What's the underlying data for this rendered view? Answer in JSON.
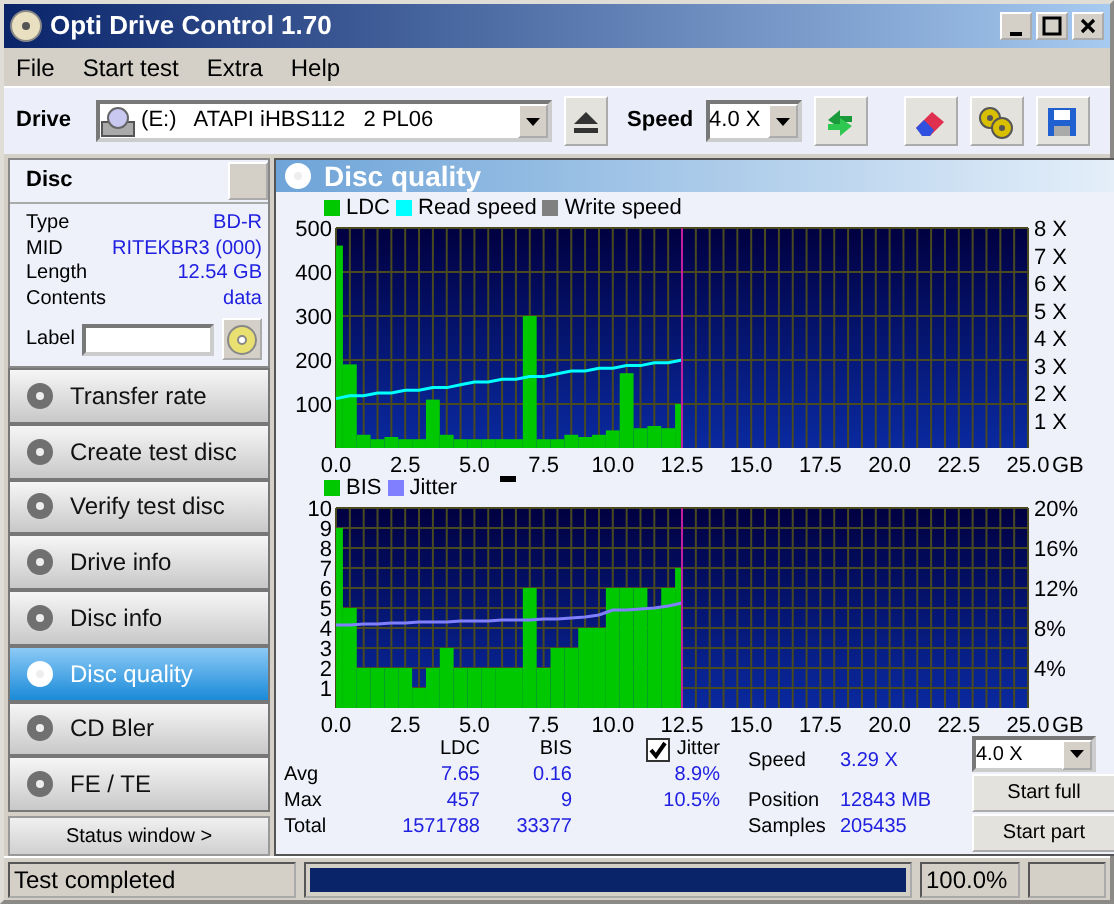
{
  "window": {
    "title": "Opti Drive Control 1.70"
  },
  "menu": [
    "File",
    "Start test",
    "Extra",
    "Help"
  ],
  "toolbar": {
    "drive_label": "Drive",
    "drive": "(E:)   ATAPI iHBS112   2 PL06",
    "speed_label": "Speed",
    "speed": "4.0 X"
  },
  "disc": {
    "title": "Disc",
    "rows": [
      {
        "label": "Type",
        "value": "BD-R"
      },
      {
        "label": "MID",
        "value": "RITEKBR3 (000)"
      },
      {
        "label": "Length",
        "value": "12.54 GB"
      },
      {
        "label": "Contents",
        "value": "data"
      }
    ],
    "label_field": "Label"
  },
  "nav": [
    {
      "label": "Transfer rate",
      "selected": false
    },
    {
      "label": "Create test disc",
      "selected": false
    },
    {
      "label": "Verify test disc",
      "selected": false
    },
    {
      "label": "Drive info",
      "selected": false
    },
    {
      "label": "Disc info",
      "selected": false
    },
    {
      "label": "Disc quality",
      "selected": true
    },
    {
      "label": "CD Bler",
      "selected": false
    },
    {
      "label": "FE / TE",
      "selected": false
    }
  ],
  "status_window_button": "Status window >",
  "panel": {
    "title": "Disc quality",
    "charts": [
      {
        "chart_data": {
          "type": "bar",
          "xlim": [
            0,
            25
          ],
          "ylim": [
            0,
            500
          ],
          "y2lim": [
            0,
            8
          ],
          "grid": true,
          "legend": true,
          "ref_lines": [
            {
              "axis": "x",
              "value": 12.5,
              "color": "#c020a0"
            }
          ],
          "x": [
            0,
            0.5,
            1,
            1.5,
            2,
            2.5,
            3,
            3.5,
            4,
            4.5,
            5,
            5.5,
            6,
            6.5,
            7,
            7.5,
            8,
            8.5,
            9,
            9.5,
            10,
            10.5,
            11,
            11.5,
            12,
            12.5
          ],
          "series": [
            {
              "name": "LDC",
              "color": "#00c800",
              "values": [
                460,
                190,
                30,
                20,
                25,
                20,
                20,
                110,
                30,
                20,
                20,
                20,
                20,
                20,
                300,
                20,
                20,
                30,
                25,
                30,
                40,
                170,
                45,
                50,
                45,
                100
              ]
            },
            {
              "name": "Read speed",
              "color": "#00ffff",
              "type": "line",
              "axis": "y2",
              "values": [
                1.8,
                1.9,
                1.9,
                2.0,
                2.0,
                2.1,
                2.1,
                2.2,
                2.2,
                2.3,
                2.4,
                2.4,
                2.5,
                2.5,
                2.6,
                2.6,
                2.7,
                2.8,
                2.8,
                2.9,
                2.9,
                3.0,
                3.0,
                3.1,
                3.1,
                3.2
              ]
            },
            {
              "name": "Write speed",
              "color": "#808080",
              "type": "line",
              "axis": "y2",
              "values": [
                null,
                null,
                null,
                null,
                null,
                null,
                null,
                null,
                null,
                null,
                null,
                null,
                null,
                null,
                null,
                null,
                null,
                null,
                null,
                null,
                null,
                null,
                null,
                null,
                null,
                null
              ]
            }
          ],
          "xticks": [
            {
              "value": 0,
              "label": "0.0"
            },
            {
              "value": 2.5,
              "label": "2.5"
            },
            {
              "value": 5,
              "label": "5.0"
            },
            {
              "value": 7.5,
              "label": "7.5"
            },
            {
              "value": 10,
              "label": "10.0"
            },
            {
              "value": 12.5,
              "label": "12.5"
            },
            {
              "value": 15,
              "label": "15.0"
            },
            {
              "value": 17.5,
              "label": "17.5"
            },
            {
              "value": 20,
              "label": "20.0"
            },
            {
              "value": 22.5,
              "label": "22.5"
            },
            {
              "value": 25,
              "label": "25.0"
            }
          ],
          "xlabel": "GB",
          "yticks": [
            100,
            200,
            300,
            400,
            500
          ],
          "y2ticks": [
            {
              "value": 1,
              "label": "1 X"
            },
            {
              "value": 2,
              "label": "2 X"
            },
            {
              "value": 3,
              "label": "3 X"
            },
            {
              "value": 4,
              "label": "4 X"
            },
            {
              "value": 5,
              "label": "5 X"
            },
            {
              "value": 6,
              "label": "6 X"
            },
            {
              "value": 7,
              "label": "7 X"
            },
            {
              "value": 8,
              "label": "8 X"
            }
          ]
        }
      },
      {
        "chart_data": {
          "type": "bar",
          "xlim": [
            0,
            25
          ],
          "ylim": [
            0,
            10
          ],
          "y2lim": [
            0,
            20
          ],
          "grid": true,
          "legend": true,
          "ref_lines": [
            {
              "axis": "x",
              "value": 12.5,
              "color": "#c020a0"
            }
          ],
          "x": [
            0,
            0.5,
            1,
            1.5,
            2,
            2.5,
            3,
            3.5,
            4,
            4.5,
            5,
            5.5,
            6,
            6.5,
            7,
            7.5,
            8,
            8.5,
            9,
            9.5,
            10,
            10.5,
            11,
            11.5,
            12,
            12.5
          ],
          "series": [
            {
              "name": "BIS",
              "color": "#00c800",
              "values": [
                9,
                5,
                2,
                2,
                2,
                2,
                1,
                2,
                3,
                2,
                2,
                2,
                2,
                2,
                6,
                2,
                3,
                3,
                4,
                4,
                6,
                6,
                6,
                5,
                6,
                7
              ]
            },
            {
              "name": "Jitter",
              "color": "#8080ff",
              "type": "line",
              "axis": "y2",
              "values": [
                8.3,
                8.3,
                8.4,
                8.4,
                8.5,
                8.5,
                8.6,
                8.6,
                8.6,
                8.7,
                8.7,
                8.7,
                8.8,
                8.8,
                8.8,
                8.9,
                8.9,
                9.0,
                9.1,
                9.3,
                9.8,
                9.8,
                9.9,
                10.0,
                10.2,
                10.5
              ]
            }
          ],
          "xticks": [
            {
              "value": 0,
              "label": "0.0"
            },
            {
              "value": 2.5,
              "label": "2.5"
            },
            {
              "value": 5,
              "label": "5.0"
            },
            {
              "value": 7.5,
              "label": "7.5"
            },
            {
              "value": 10,
              "label": "10.0"
            },
            {
              "value": 12.5,
              "label": "12.5"
            },
            {
              "value": 15,
              "label": "15.0"
            },
            {
              "value": 17.5,
              "label": "17.5"
            },
            {
              "value": 20,
              "label": "20.0"
            },
            {
              "value": 22.5,
              "label": "22.5"
            },
            {
              "value": 25,
              "label": "25.0"
            }
          ],
          "xlabel": "GB",
          "yticks": [
            1,
            2,
            3,
            4,
            5,
            6,
            7,
            8,
            9,
            10
          ],
          "y2ticks": [
            {
              "value": 4,
              "label": "4%"
            },
            {
              "value": 8,
              "label": "8%"
            },
            {
              "value": 12,
              "label": "12%"
            },
            {
              "value": 16,
              "label": "16%"
            },
            {
              "value": 20,
              "label": "20%"
            }
          ]
        }
      }
    ]
  },
  "stats": {
    "columns": [
      "LDC",
      "BIS"
    ],
    "rows": [
      {
        "label": "Avg",
        "ldc": "7.65",
        "bis": "0.16",
        "jitter": "8.9%"
      },
      {
        "label": "Max",
        "ldc": "457",
        "bis": "9",
        "jitter": "10.5%"
      },
      {
        "label": "Total",
        "ldc": "1571788",
        "bis": "33377"
      }
    ],
    "jitter_checkbox": {
      "label": "Jitter",
      "checked": true
    },
    "info": [
      {
        "label": "Speed",
        "value": "3.29 X"
      },
      {
        "label": "Position",
        "value": "12843 MB"
      },
      {
        "label": "Samples",
        "value": "205435"
      }
    ],
    "speed": "4.0 X",
    "buttons": [
      "Start full",
      "Start part"
    ]
  },
  "status_bar": {
    "text": "Test completed",
    "level": 1.0,
    "percent": "100.0%"
  }
}
